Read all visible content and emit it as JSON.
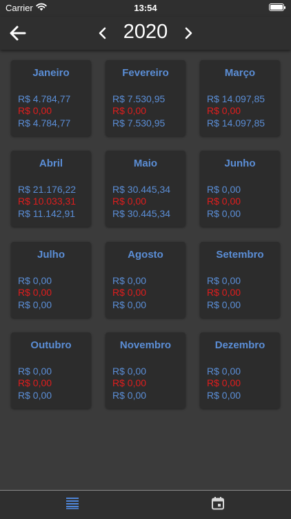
{
  "status_bar": {
    "carrier": "Carrier",
    "time": "13:54"
  },
  "header": {
    "year": "2020"
  },
  "colors": {
    "accent": "#5b8ed6",
    "negative": "#e11d1d",
    "card_bg": "#2c2c2c",
    "page_bg": "#3b3b3b"
  },
  "months": [
    {
      "name": "Janeiro",
      "income": "R$ 4.784,77",
      "expense": "R$ 0,00",
      "balance": "R$ 4.784,77"
    },
    {
      "name": "Fevereiro",
      "income": "R$ 7.530,95",
      "expense": "R$ 0,00",
      "balance": "R$ 7.530,95"
    },
    {
      "name": "Março",
      "income": "R$ 14.097,85",
      "expense": "R$ 0,00",
      "balance": "R$ 14.097,85"
    },
    {
      "name": "Abril",
      "income": "R$ 21.176,22",
      "expense": "R$ 10.033,31",
      "balance": "R$ 11.142,91"
    },
    {
      "name": "Maio",
      "income": "R$ 30.445,34",
      "expense": "R$ 0,00",
      "balance": "R$ 30.445,34"
    },
    {
      "name": "Junho",
      "income": "R$ 0,00",
      "expense": "R$ 0,00",
      "balance": "R$ 0,00"
    },
    {
      "name": "Julho",
      "income": "R$ 0,00",
      "expense": "R$ 0,00",
      "balance": "R$ 0,00"
    },
    {
      "name": "Agosto",
      "income": "R$ 0,00",
      "expense": "R$ 0,00",
      "balance": "R$ 0,00"
    },
    {
      "name": "Setembro",
      "income": "R$ 0,00",
      "expense": "R$ 0,00",
      "balance": "R$ 0,00"
    },
    {
      "name": "Outubro",
      "income": "R$ 0,00",
      "expense": "R$ 0,00",
      "balance": "R$ 0,00"
    },
    {
      "name": "Novembro",
      "income": "R$ 0,00",
      "expense": "R$ 0,00",
      "balance": "R$ 0,00"
    },
    {
      "name": "Dezembro",
      "income": "R$ 0,00",
      "expense": "R$ 0,00",
      "balance": "R$ 0,00"
    }
  ],
  "tab_bar": {
    "tabs": [
      {
        "icon": "list-icon",
        "active": true
      },
      {
        "icon": "calendar-icon",
        "active": false
      }
    ]
  }
}
